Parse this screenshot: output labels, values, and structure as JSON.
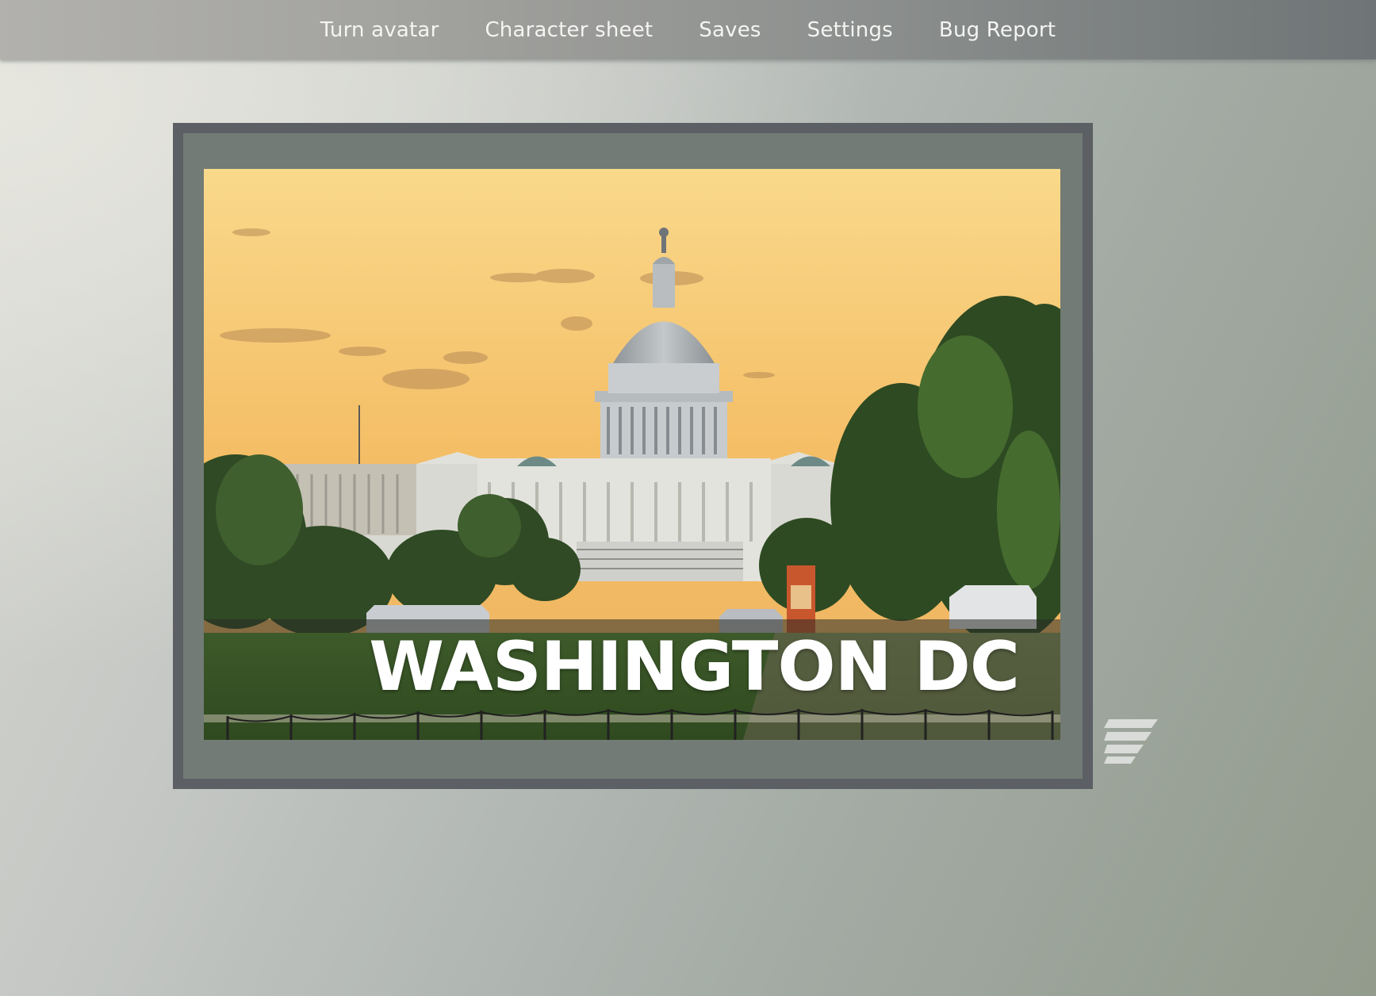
{
  "nav": {
    "items": [
      {
        "label": "Turn avatar"
      },
      {
        "label": "Character sheet"
      },
      {
        "label": "Saves"
      },
      {
        "label": "Settings"
      },
      {
        "label": "Bug Report"
      }
    ]
  },
  "location": {
    "title": "WASHINGTON DC",
    "scene_icon": "capitol-building"
  },
  "side_menu": {
    "icon": "menu-lines-icon"
  },
  "colors": {
    "nav_text": "#f4f4f2",
    "frame_outer": "#5c6064",
    "frame_inner": "#727b75",
    "sky_top": "#f7cf7a",
    "sky_bottom": "#f0a84c"
  }
}
